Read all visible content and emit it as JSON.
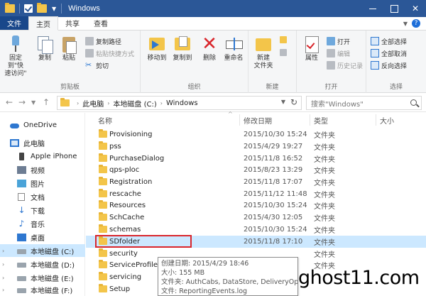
{
  "window": {
    "title": "Windows",
    "close_glyph": "✕",
    "colors": {
      "titlebar": "#2b5797",
      "file_tab": "#19478a",
      "selection": "#cce8ff",
      "highlight_box": "#d9262c"
    }
  },
  "ribbon": {
    "tabs": [
      "文件",
      "主页",
      "共享",
      "查看"
    ],
    "clipboard": {
      "label": "剪贴板",
      "pin_quick_access": "固定到\"快\n速访问\"",
      "copy": "复制",
      "paste": "粘贴",
      "copy_path": "复制路径",
      "paste_shortcut": "粘贴快捷方式",
      "cut": "剪切"
    },
    "organize": {
      "label": "组织",
      "move_to": "移动到",
      "copy_to": "复制到",
      "delete": "删除",
      "rename": "重命名"
    },
    "new": {
      "label": "新建",
      "new_folder": "新建\n文件夹"
    },
    "open": {
      "label": "打开",
      "properties": "属性",
      "open": "打开",
      "edit": "编辑",
      "history": "历史记录"
    },
    "select": {
      "label": "选择",
      "select_all": "全部选择",
      "select_none": "全部取消",
      "invert": "反向选择"
    }
  },
  "address": {
    "crumbs": [
      "此电脑",
      "本地磁盘 (C:)",
      "Windows"
    ],
    "search_placeholder": "搜索\"Windows\""
  },
  "nav_pane": {
    "items": [
      {
        "label": "OneDrive",
        "icon": "onedrive-icon"
      },
      {
        "label": "此电脑",
        "icon": "pc-icon"
      },
      {
        "label": "Apple iPhone",
        "icon": "phone-icon"
      },
      {
        "label": "视频",
        "icon": "video-icon"
      },
      {
        "label": "图片",
        "icon": "pictures-icon"
      },
      {
        "label": "文档",
        "icon": "documents-icon"
      },
      {
        "label": "下载",
        "icon": "downloads-icon"
      },
      {
        "label": "音乐",
        "icon": "music-icon"
      },
      {
        "label": "桌面",
        "icon": "desktop-icon"
      },
      {
        "label": "本地磁盘 (C:)",
        "icon": "drive-icon",
        "selected": true
      },
      {
        "label": "本地磁盘 (D:)",
        "icon": "drive-icon"
      },
      {
        "label": "本地磁盘 (E:)",
        "icon": "drive-icon"
      },
      {
        "label": "本地磁盘 (F:)",
        "icon": "drive-icon"
      }
    ]
  },
  "file_list": {
    "columns": [
      "名称",
      "修改日期",
      "类型",
      "大小"
    ],
    "rows": [
      {
        "name": "Provisioning",
        "date": "2015/10/30 15:24",
        "type": "文件夹"
      },
      {
        "name": "pss",
        "date": "2015/4/29 19:27",
        "type": "文件夹"
      },
      {
        "name": "PurchaseDialog",
        "date": "2015/11/8 16:52",
        "type": "文件夹"
      },
      {
        "name": "qps-ploc",
        "date": "2015/8/23 13:29",
        "type": "文件夹"
      },
      {
        "name": "Registration",
        "date": "2015/11/8 17:07",
        "type": "文件夹"
      },
      {
        "name": "rescache",
        "date": "2015/11/12 11:48",
        "type": "文件夹"
      },
      {
        "name": "Resources",
        "date": "2015/10/30 15:24",
        "type": "文件夹"
      },
      {
        "name": "SchCache",
        "date": "2015/4/30 12:05",
        "type": "文件夹"
      },
      {
        "name": "schemas",
        "date": "2015/10/30 15:24",
        "type": "文件夹"
      },
      {
        "name": "SDfolder",
        "date": "2015/11/8 17:10",
        "type": "文件夹",
        "selected": true
      },
      {
        "name": "security",
        "date": "",
        "type": "文件夹"
      },
      {
        "name": "ServiceProfiles",
        "date": "",
        "type": "文件夹"
      },
      {
        "name": "servicing",
        "date": "",
        "type": ""
      },
      {
        "name": "Setup",
        "date": "",
        "type": ""
      }
    ]
  },
  "tooltip": {
    "created": "创建日期: 2015/4/29 18:46",
    "size": "大小: 155 MB",
    "folders": "文件夹: AuthCabs, DataStore, DeliveryOptimization",
    "files": "文件: ReportingEvents.log"
  },
  "watermark": "ghost11.com"
}
